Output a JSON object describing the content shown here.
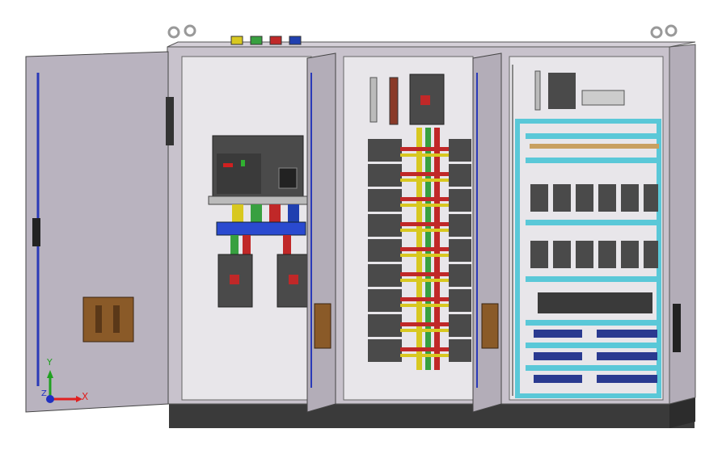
{
  "scene": {
    "description_free": true
  },
  "axis_triad": {
    "x_label": "X",
    "y_label": "Y",
    "z_label": "Z"
  },
  "colors": {
    "cabinet_frame": "#c8c2cc",
    "cabinet_interior": "#e8e6ea",
    "door": "#b9b3bf",
    "plinth": "#3a3a3a",
    "busbar_yellow": "#d8c820",
    "busbar_green": "#38a040",
    "busbar_red": "#c02828",
    "busbar_blue": "#2040b0",
    "breaker_dark": "#4a4a4a",
    "din_rail_cyan": "#5ac8d8",
    "handle_brown": "#8a5a28"
  },
  "terminal_caps": [
    "yellow",
    "green",
    "red",
    "blue"
  ]
}
